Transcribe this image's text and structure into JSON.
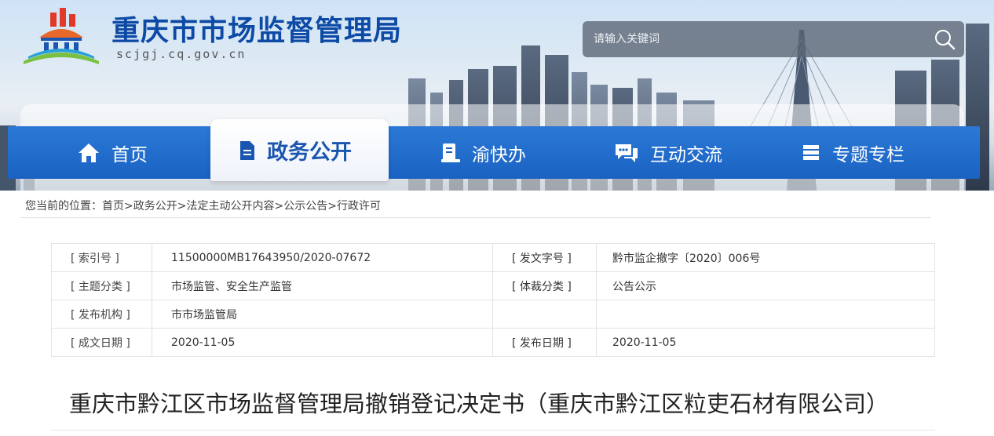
{
  "header": {
    "site_title": "重庆市市场监督管理局",
    "site_domain": "scjgj.cq.gov.cn",
    "search_placeholder": "请输入关键词",
    "colors": {
      "title": "#0d4aa6",
      "nav_bg": "#1a62c2",
      "active_text": "#1a56b0"
    }
  },
  "nav": {
    "items": [
      {
        "label": "首页",
        "icon": "home-icon"
      },
      {
        "label": "政务公开",
        "icon": "document-icon",
        "active": true
      },
      {
        "label": "渝快办",
        "icon": "id-card-icon"
      },
      {
        "label": "互动交流",
        "icon": "chat-icon"
      },
      {
        "label": "专题专栏",
        "icon": "stack-icon"
      }
    ]
  },
  "breadcrumb": {
    "prefix": "您当前的位置：",
    "items": [
      "首页",
      "政务公开",
      "法定主动公开内容",
      "公示公告",
      "行政许可"
    ],
    "separator": ">"
  },
  "info": {
    "index_label": "[ 索引号 ]",
    "index_value": "11500000MB17643950/2020-07672",
    "doc_no_label": "[ 发文字号 ]",
    "doc_no_value": "黔市监企撤字〔2020〕006号",
    "topic_label": "[ 主题分类 ]",
    "topic_value": "市场监管、安全生产监管",
    "genre_label": "[ 体裁分类 ]",
    "genre_value": "公告公示",
    "issuer_label": "[ 发布机构 ]",
    "issuer_value": "市市场监管局",
    "created_label": "[ 成文日期 ]",
    "created_value": "2020-11-05",
    "published_label": "[ 发布日期 ]",
    "published_value": "2020-11-05"
  },
  "article": {
    "title": "重庆市黔江区市场监督管理局撤销登记决定书（重庆市黔江区粒吏石材有限公司）"
  }
}
